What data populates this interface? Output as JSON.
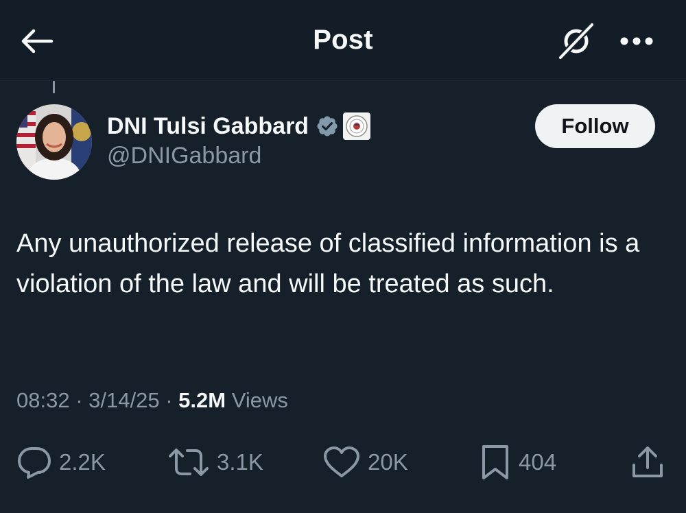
{
  "header": {
    "title": "Post",
    "back_icon": "arrow-left-icon",
    "grok_icon": "grok-icon",
    "more_icon": "more-horizontal-icon"
  },
  "author": {
    "display_name": "DNI Tulsi Gabbard",
    "handle": "@DNIGabbard",
    "verified_icon": "verified-badge-icon",
    "verified_color": "#829aab",
    "affiliation_icon": "government-seal-icon"
  },
  "follow": {
    "label": "Follow"
  },
  "post": {
    "text": "Any unauthorized release of classified information is a violation of the law and will be treated as such."
  },
  "meta": {
    "time": "08:32",
    "separator1": "·",
    "date": "3/14/25",
    "separator2": "·",
    "views_count": "5.2M",
    "views_label": "Views"
  },
  "actions": {
    "replies": "2.2K",
    "reposts": "3.1K",
    "likes": "20K",
    "bookmarks": "404"
  },
  "colors": {
    "background": "#15202b",
    "text_primary": "#f7f9f9",
    "text_secondary": "#8b98a5"
  }
}
